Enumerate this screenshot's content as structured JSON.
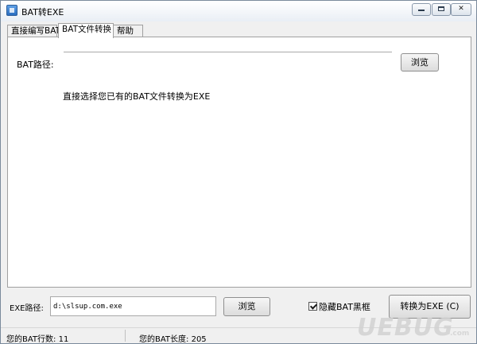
{
  "window": {
    "title": "BAT转EXE"
  },
  "tabs": [
    {
      "label": "直接编写BAT"
    },
    {
      "label": "BAT文件转换"
    },
    {
      "label": "帮助"
    }
  ],
  "active_tab": 1,
  "convert_tab": {
    "bat_path_label": "BAT路径:",
    "bat_path_value": "",
    "browse_label": "浏览",
    "hint": "直接选择您已有的BAT文件转换为EXE"
  },
  "bottom": {
    "exe_path_label": "EXE路径:",
    "exe_path_value": "d:\\slsup.com.exe",
    "browse_label": "浏览",
    "hide_console_label": "隐藏BAT黑框",
    "hide_console_checked": true,
    "convert_label": "转换为EXE (C)"
  },
  "status": {
    "lines": "您的BAT行数: 11",
    "length": "您的BAT长度: 205"
  },
  "watermark": {
    "main": "UEBUG",
    "sub": ".com"
  }
}
